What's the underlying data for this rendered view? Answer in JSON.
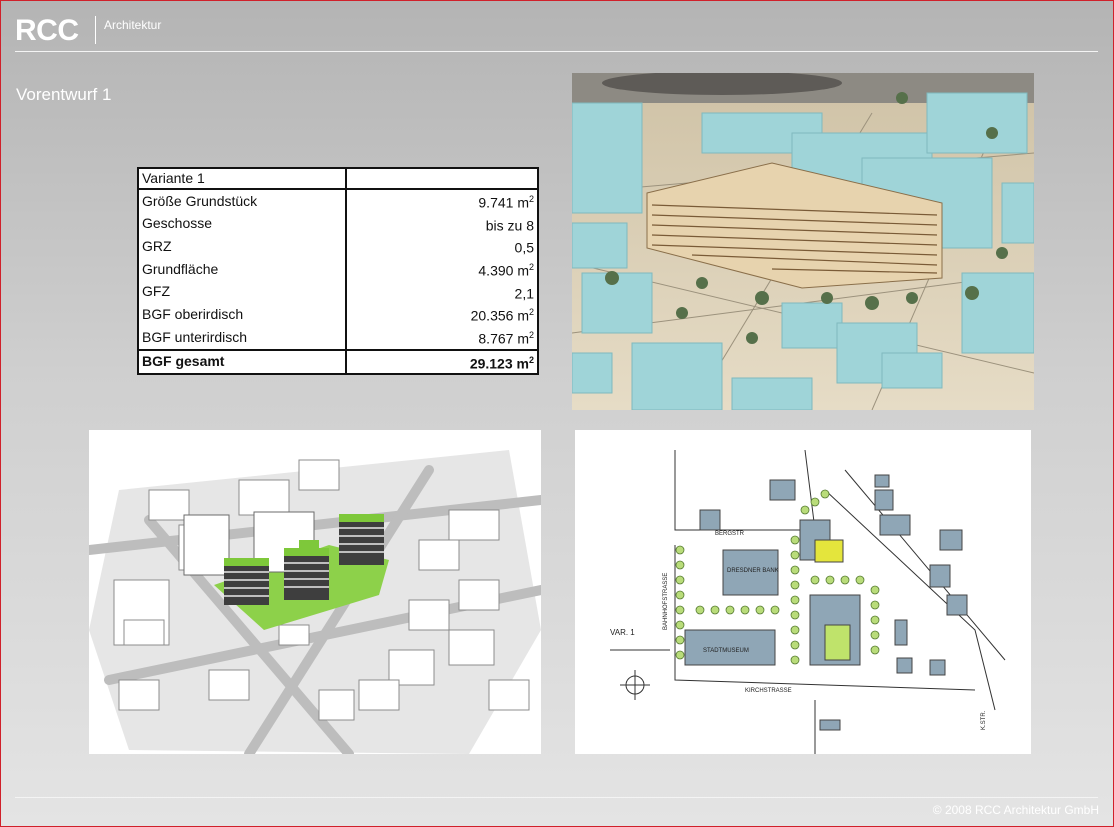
{
  "header": {
    "brand": "RCC",
    "brand_sub": "Architektur"
  },
  "page": {
    "title": "Vorentwurf 1"
  },
  "table": {
    "heading": "Variante 1",
    "rows": [
      {
        "label": "Größe Grundstück",
        "value": "9.741 m",
        "unit_sup": "2"
      },
      {
        "label": "Geschosse",
        "value": "bis zu 8",
        "unit_sup": ""
      },
      {
        "label": "GRZ",
        "value": "0,5",
        "unit_sup": ""
      },
      {
        "label": "Grundfläche",
        "value": "4.390 m",
        "unit_sup": "2"
      },
      {
        "label": "GFZ",
        "value": "2,1",
        "unit_sup": ""
      },
      {
        "label": "BGF oberirdisch",
        "value": "20.356 m",
        "unit_sup": "2"
      },
      {
        "label": "BGF unterirdisch",
        "value": "8.767 m",
        "unit_sup": "2"
      }
    ],
    "total": {
      "label": "BGF gesamt",
      "value": "29.123 m",
      "unit_sup": "2"
    }
  },
  "sketch": {
    "labels": {
      "bank": "DRESDNER BANK",
      "museum": "STADTMUSEUM",
      "variant": "VAR. 1",
      "street_top": "BERGSTR",
      "street_left": "BAHNHOFSTRASSE",
      "street_bottom": "KIRCHSTRASSE",
      "street_right": "K.STR."
    }
  },
  "footer": {
    "copyright": "© 2008 RCC Architektur GmbH"
  },
  "colors": {
    "frame_border": "#d0202a",
    "model_block": "#9fd4d8",
    "model_base": "#d8c7a5",
    "render_green": "#7ec83a"
  }
}
